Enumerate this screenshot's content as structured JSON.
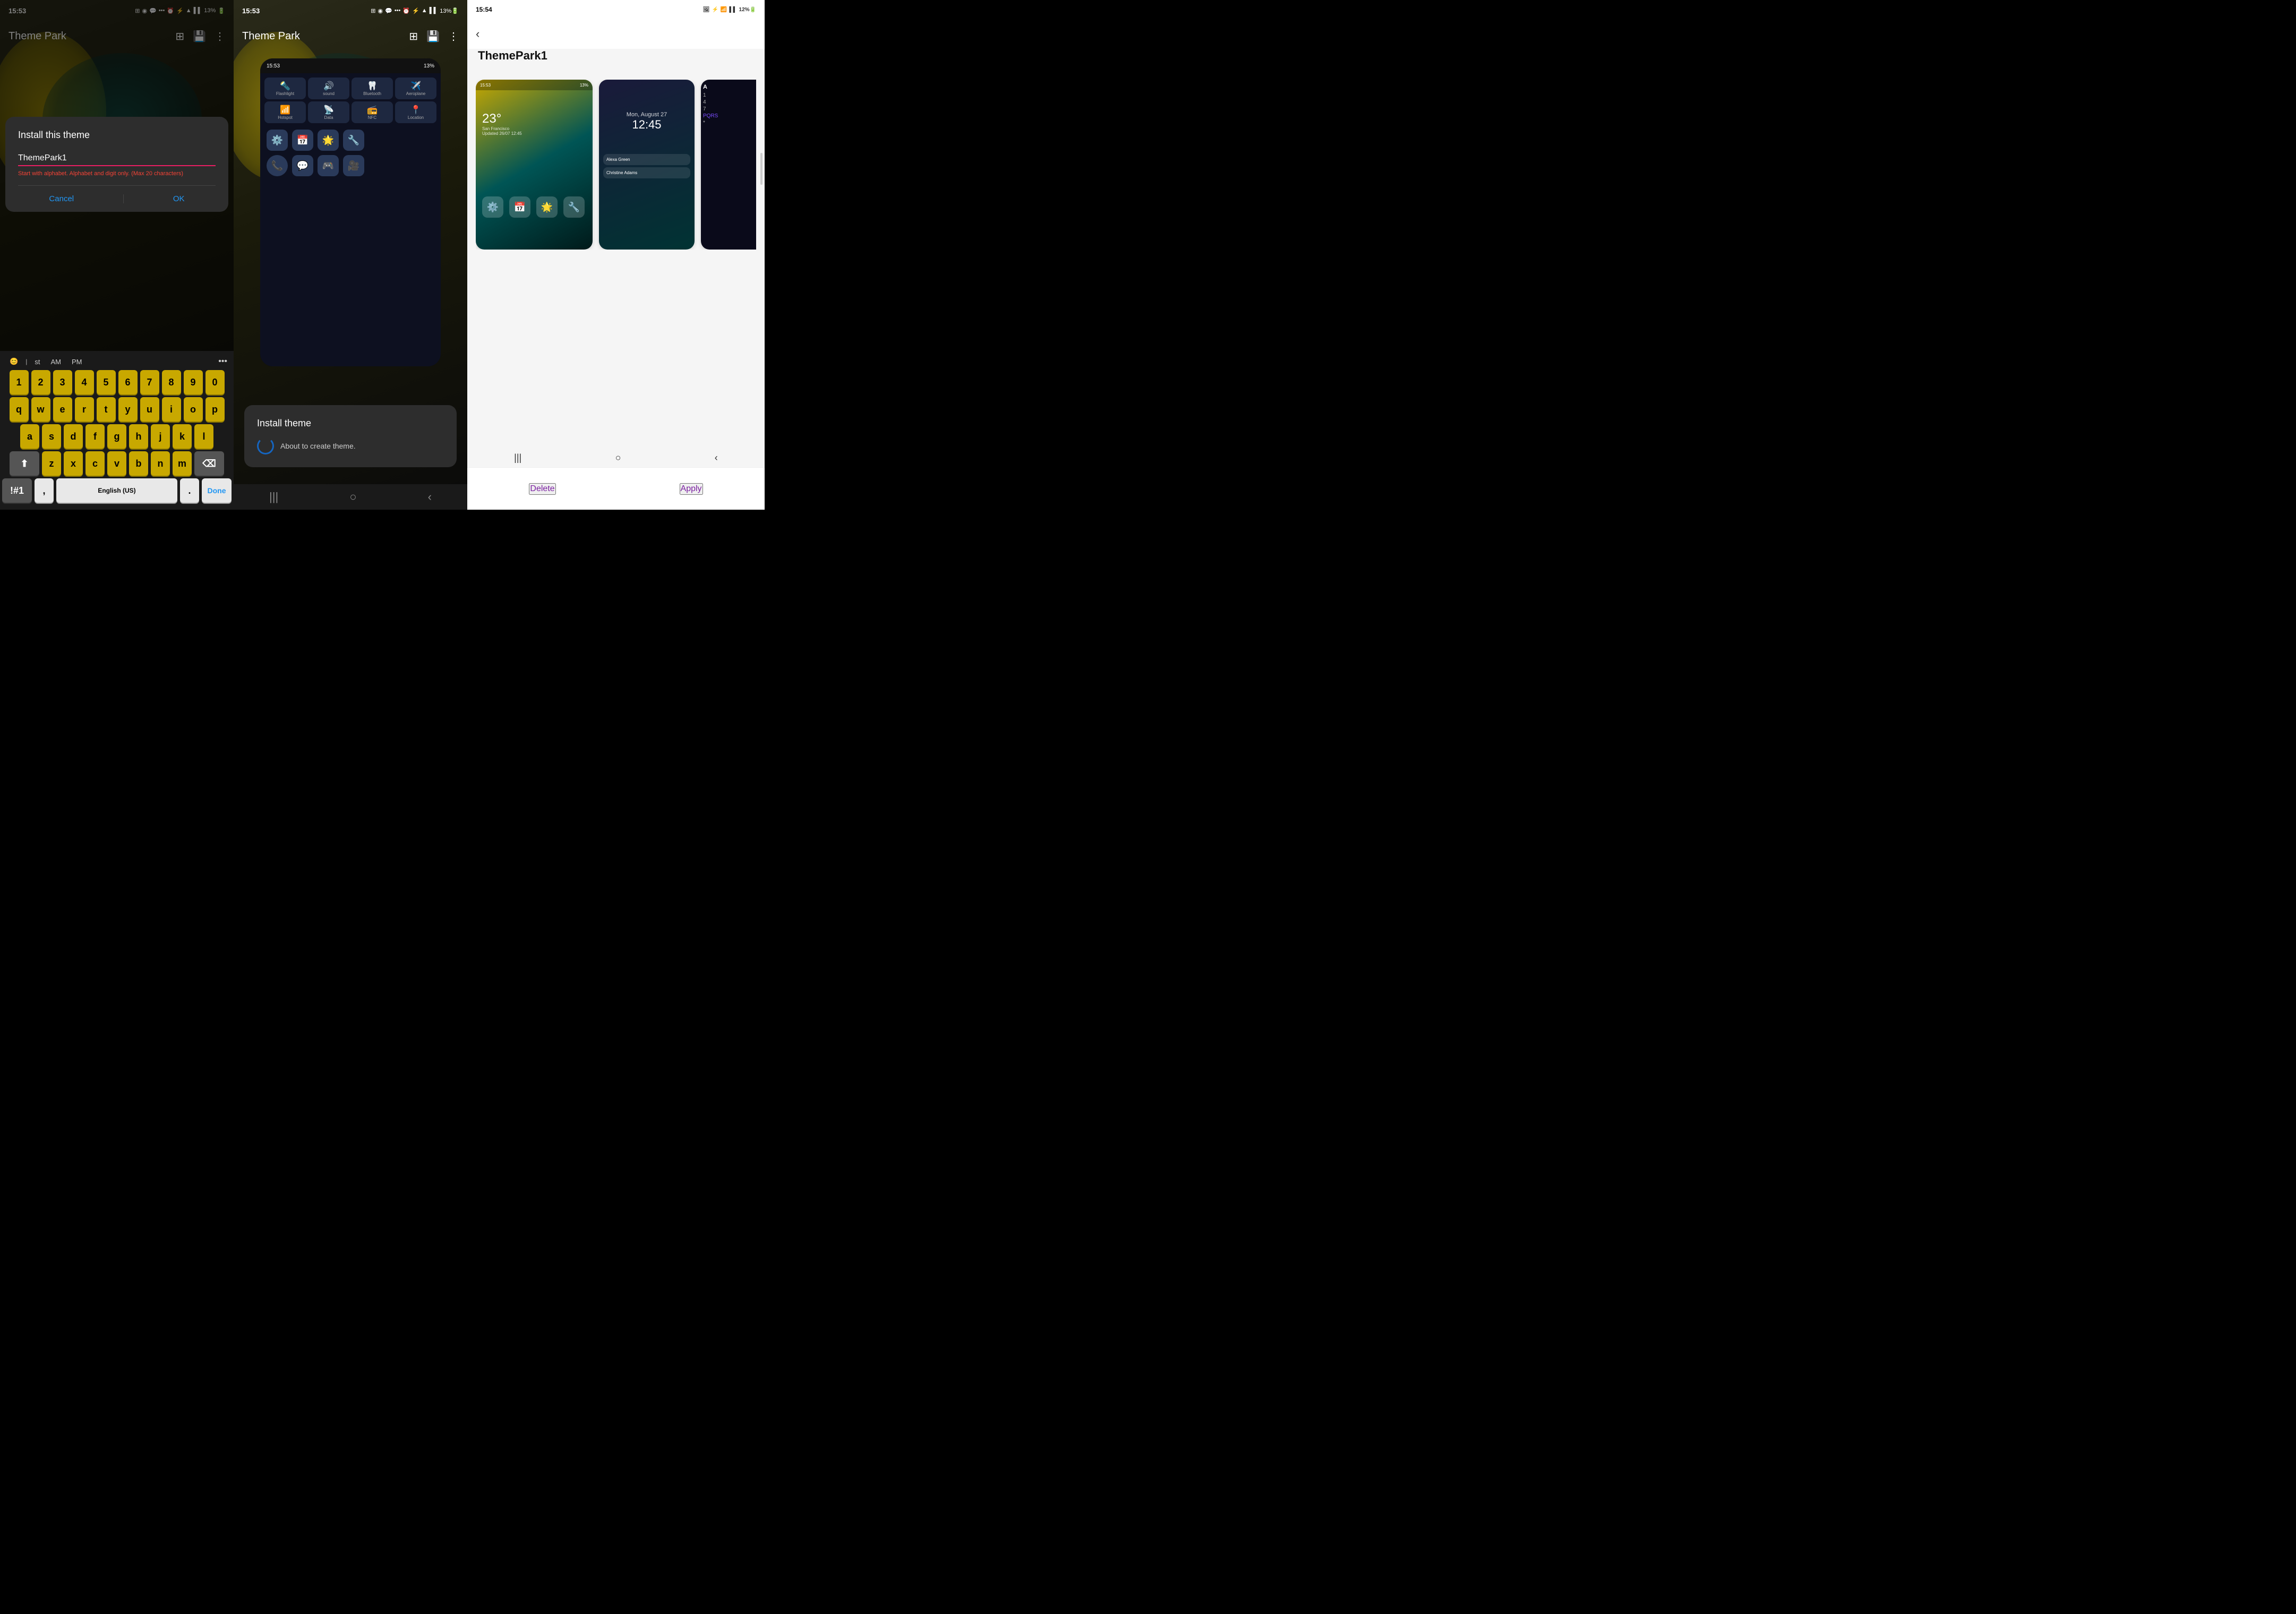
{
  "panel1": {
    "status_time": "15:53",
    "app_title": "Theme Park",
    "dialog": {
      "title": "Install this theme",
      "input_value": "ThemePark1",
      "error_text": "Start with alphabet. Alphabet and digit only. (Max 20 characters)",
      "cancel_label": "Cancel",
      "ok_label": "OK"
    },
    "keyboard": {
      "suggestion1": "st",
      "suggestion2": "AM",
      "suggestion3": "PM",
      "lang_label": "English (US)",
      "done_label": "Done",
      "special_label": "!#1",
      "comma_label": ",",
      "period_label": ".",
      "rows": [
        [
          "1",
          "2",
          "3",
          "4",
          "5",
          "6",
          "7",
          "8",
          "9",
          "0"
        ],
        [
          "q",
          "w",
          "e",
          "r",
          "t",
          "y",
          "u",
          "i",
          "o",
          "p"
        ],
        [
          "a",
          "s",
          "d",
          "f",
          "g",
          "h",
          "j",
          "k",
          "l"
        ],
        [
          "z",
          "x",
          "c",
          "v",
          "b",
          "n",
          "m"
        ]
      ]
    }
  },
  "panel2": {
    "status_time": "15:53",
    "app_title": "Theme Park",
    "phone_tiles": [
      {
        "label": "Flashlight"
      },
      {
        "label": "sound"
      },
      {
        "label": "Bluetooth"
      },
      {
        "label": "Aeroplane"
      },
      {
        "label": "Hotspot"
      },
      {
        "label": "Data"
      },
      {
        "label": "NFC"
      },
      {
        "label": "Location"
      }
    ],
    "install_popup": {
      "title": "Install theme",
      "text": "About to create theme."
    }
  },
  "panel3": {
    "status_time": "15:54",
    "theme_name": "ThemePark1",
    "back_icon": "‹",
    "preview1_temp": "23°",
    "preview1_location": "San Francisco",
    "preview1_updated": "Updated 26/07 12:45",
    "preview2_date": "Mon, August 27",
    "preview2_time": "12:45",
    "bottom": {
      "delete_label": "Delete",
      "apply_label": "Apply"
    }
  }
}
